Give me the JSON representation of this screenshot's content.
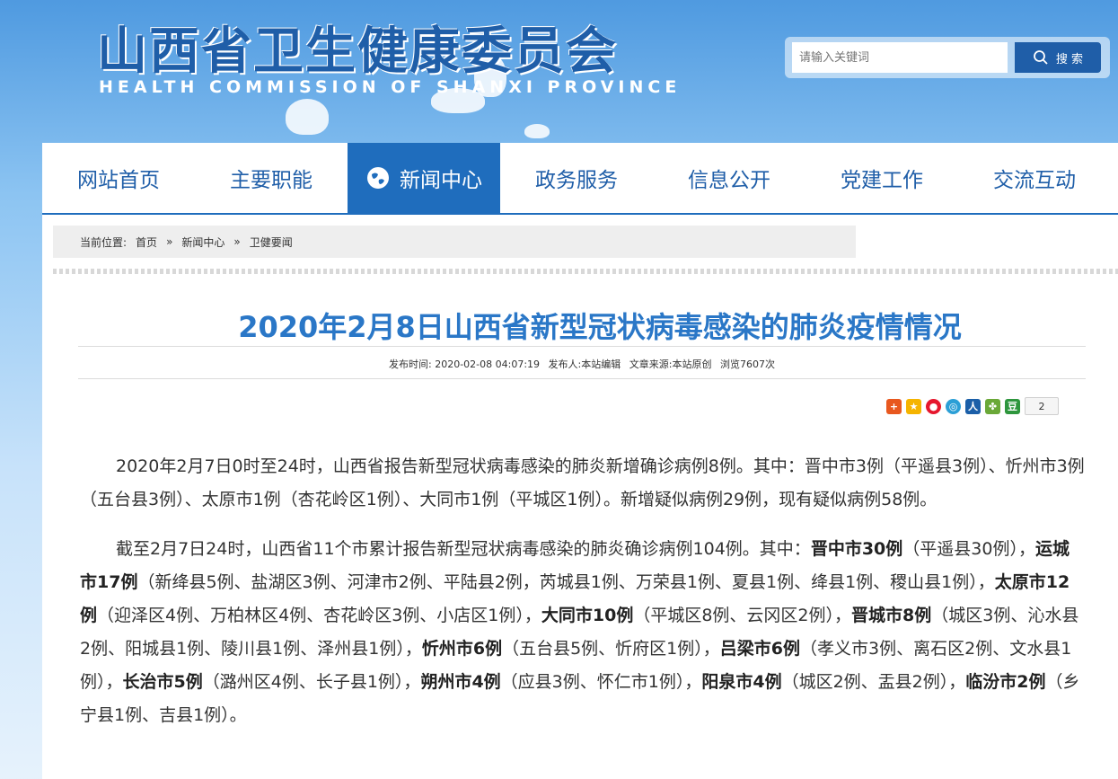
{
  "header": {
    "title": "山西省卫生健康委员会",
    "subtitle": "HEALTH COMMISSION OF SHANXI PROVINCE",
    "search": {
      "placeholder": "请输入关键词",
      "button_label": "搜 索"
    }
  },
  "nav": {
    "items": [
      {
        "label": "网站首页"
      },
      {
        "label": "主要职能"
      },
      {
        "label": "新闻中心",
        "active": true
      },
      {
        "label": "政务服务"
      },
      {
        "label": "信息公开"
      },
      {
        "label": "党建工作"
      },
      {
        "label": "交流互动"
      }
    ]
  },
  "breadcrumb": {
    "prefix": "当前位置:",
    "items": [
      "首页",
      "新闻中心",
      "卫健要闻"
    ],
    "separator": "»"
  },
  "article": {
    "title": "2020年2月8日山西省新型冠状病毒感染的肺炎疫情情况",
    "meta": {
      "published": "发布时间:   2020-02-08 04:07:19",
      "publisher": "发布人:本站编辑",
      "source": "文章来源:本站原创",
      "views": "浏览7607次"
    },
    "share_count": "2",
    "p1": "2020年2月7日0时至24时，山西省报告新型冠状病毒感染的肺炎新增确诊病例8例。其中：晋中市3例（平遥县3例）、忻州市3例（五台县3例）、太原市1例（杏花岭区1例）、大同市1例（平城区1例）。新增疑似病例29例，现有疑似病例58例。",
    "p2": {
      "intro": "截至2月7日24时，山西省11个市累计报告新型冠状病毒感染的肺炎确诊病例104例。其中：",
      "cities": [
        {
          "name": "晋中市30例",
          "detail": "（平遥县30例），"
        },
        {
          "name": "运城市17例",
          "detail": "（新绛县5例、盐湖区3例、河津市2例、平陆县2例，芮城县1例、万荣县1例、夏县1例、绛县1例、稷山县1例），"
        },
        {
          "name": "太原市12例",
          "detail": "（迎泽区4例、万柏林区4例、杏花岭区3例、小店区1例），"
        },
        {
          "name": "大同市10例",
          "detail": "（平城区8例、云冈区2例），"
        },
        {
          "name": "晋城市8例",
          "detail": "（城区3例、沁水县2例、阳城县1例、陵川县1例、泽州县1例），"
        },
        {
          "name": "忻州市6例",
          "detail": "（五台县5例、忻府区1例），"
        },
        {
          "name": "吕梁市6例",
          "detail": "（孝义市3例、离石区2例、文水县1例），"
        },
        {
          "name": "长治市5例",
          "detail": "（潞州区4例、长子县1例），"
        },
        {
          "name": "朔州市4例",
          "detail": "（应县3例、怀仁市1例），"
        },
        {
          "name": "阳泉市4例",
          "detail": "（城区2例、盂县2例），"
        },
        {
          "name": "临汾市2例",
          "detail": "（乡宁县1例、吉县1例）。"
        }
      ]
    }
  },
  "colors": {
    "primary": "#1f6dbd",
    "title": "#2a77c7"
  }
}
